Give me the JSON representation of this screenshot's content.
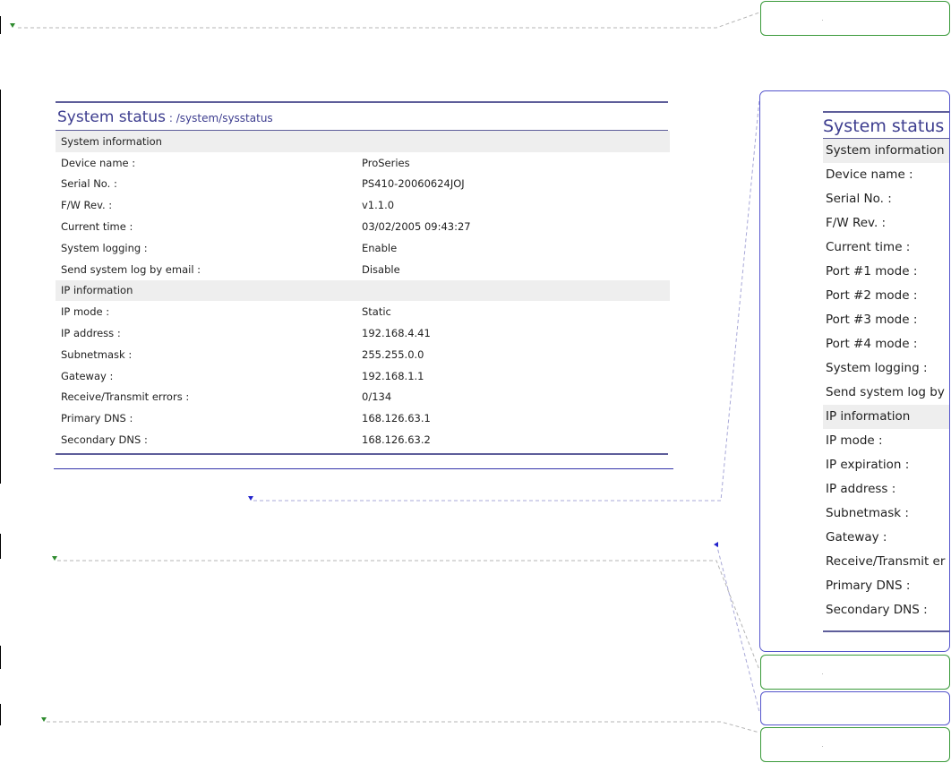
{
  "main_panel": {
    "title": "System status",
    "path_separator": " : ",
    "path_sep": "/",
    "path_parts": [
      "system",
      "sysstatus"
    ],
    "sections": [
      {
        "label": "System information",
        "rows": [
          {
            "label": "Device name :",
            "value": "ProSeries"
          },
          {
            "label": "Serial No. :",
            "value": "PS410-20060624JOJ"
          },
          {
            "label": "F/W Rev. :",
            "value": "v1.1.0"
          },
          {
            "label": "Current time :",
            "value": "03/02/2005 09:43:27"
          },
          {
            "label": "System logging :",
            "value": "Enable"
          },
          {
            "label": "Send system log by email :",
            "value": "Disable"
          }
        ]
      },
      {
        "label": "IP information",
        "rows": [
          {
            "label": "IP mode :",
            "value": "Static"
          },
          {
            "label": "IP address :",
            "value": "192.168.4.41"
          },
          {
            "label": "Subnetmask :",
            "value": "255.255.0.0"
          },
          {
            "label": "Gateway :",
            "value": "192.168.1.1"
          },
          {
            "label": "Receive/Transmit errors :",
            "value": "0/134"
          },
          {
            "label": "Primary DNS :",
            "value": "168.126.63.1"
          },
          {
            "label": "Secondary DNS :",
            "value": "168.126.63.2"
          }
        ]
      }
    ]
  },
  "side_panel": {
    "title": "System status",
    "rows": [
      {
        "label": "System information",
        "section": true
      },
      {
        "label": "Device name :"
      },
      {
        "label": "Serial No. :"
      },
      {
        "label": "F/W Rev. :"
      },
      {
        "label": "Current time :"
      },
      {
        "label": "Port #1 mode :"
      },
      {
        "label": "Port #2 mode :"
      },
      {
        "label": "Port #3 mode :"
      },
      {
        "label": "Port #4 mode :"
      },
      {
        "label": "System logging :"
      },
      {
        "label": "Send system log by"
      },
      {
        "label": "IP information",
        "section": true
      },
      {
        "label": "IP mode :"
      },
      {
        "label": "IP expiration :"
      },
      {
        "label": "IP address :"
      },
      {
        "label": "Subnetmask :"
      },
      {
        "label": "Gateway :"
      },
      {
        "label": "Receive/Transmit er"
      },
      {
        "label": "Primary DNS :"
      },
      {
        "label": "Secondary DNS :"
      }
    ]
  },
  "colors": {
    "heading": "#3d3d8f",
    "rule": "#5e5e9a",
    "section_bg": "#eeeeee",
    "balloon_green": "#3a9a3a",
    "balloon_blue": "#5555cc"
  }
}
